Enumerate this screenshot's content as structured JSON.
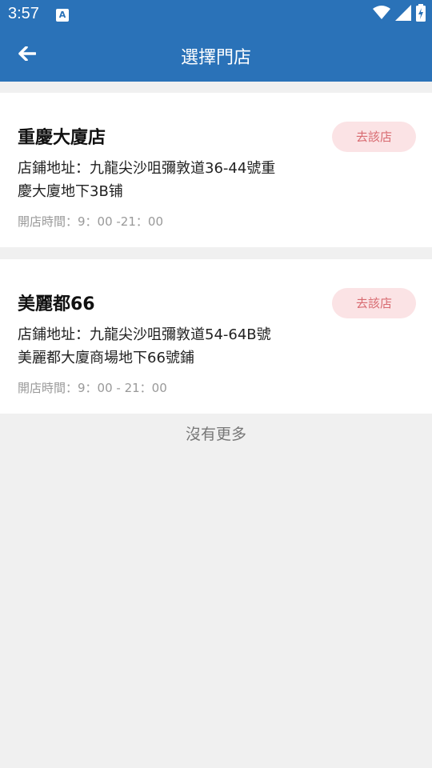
{
  "status_bar": {
    "time": "3:57",
    "app_icon_letter": "A",
    "icons": [
      "wifi-icon",
      "signal-icon",
      "battery-charging-icon"
    ]
  },
  "toolbar": {
    "back_icon": "back-arrow-icon",
    "title": "選擇門店"
  },
  "stores": [
    {
      "name": "重慶大廈店",
      "button": "去該店",
      "address_line1": "店鋪地址：九龍尖沙咀彌敦道36-44號重",
      "address_line2": "慶大廈地下3B铺",
      "hours": "開店時間：9：00 -21：00"
    },
    {
      "name": "美麗都66",
      "button": "去該店",
      "address_line1": "店鋪地址：九龍尖沙咀彌敦道54-64B號",
      "address_line2": "美麗都大廈商場地下66號鋪",
      "hours": "開店時間：9：00 - 21：00"
    }
  ],
  "footer": {
    "no_more": "沒有更多"
  },
  "colors": {
    "primary": "#2a72b8",
    "background": "#f0f0f0",
    "button_bg": "#fbe3e5",
    "button_text": "#d86a70"
  }
}
